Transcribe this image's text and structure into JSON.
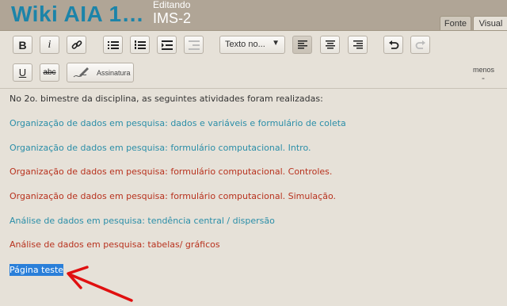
{
  "header": {
    "wiki_title": "Wiki AIA 1…",
    "edit_label": "Editando",
    "page_name": "IMS-2"
  },
  "tabs": [
    {
      "label": "Fonte"
    },
    {
      "label": "Visual"
    }
  ],
  "toolbar": {
    "format_dropdown": "Texto no...",
    "signature_label": "Assinatura",
    "less_label": "menos",
    "less_dash": "-"
  },
  "editor": {
    "lines": [
      {
        "text": "No 2o. bimestre da disciplina, as seguintes atividades foram realizadas:",
        "color": "dark"
      },
      {
        "text": "Organização de dados em pesquisa: dados e variáveis e formulário de coleta",
        "color": "teal"
      },
      {
        "text": "Organização de dados em pesquisa: formulário computacional. Intro.",
        "color": "teal"
      },
      {
        "text": "Organização de dados em pesquisa: formulário computacional. Controles.",
        "color": "red"
      },
      {
        "text": "Organização de dados em pesquisa: formulário computacional. Simulação.",
        "color": "red"
      },
      {
        "text": "Análise de dados em pesquisa: tendência central / dispersão",
        "color": "teal"
      },
      {
        "text": "Análise de dados em pesquisa: tabelas/ gráficos",
        "color": "red"
      }
    ],
    "selected_text": "Página teste"
  },
  "colors": {
    "title": "#1c84a9",
    "teal": "#2b8ea8",
    "red": "#b8321e",
    "selection": "#2a7fd9",
    "arrow": "#e01010"
  }
}
